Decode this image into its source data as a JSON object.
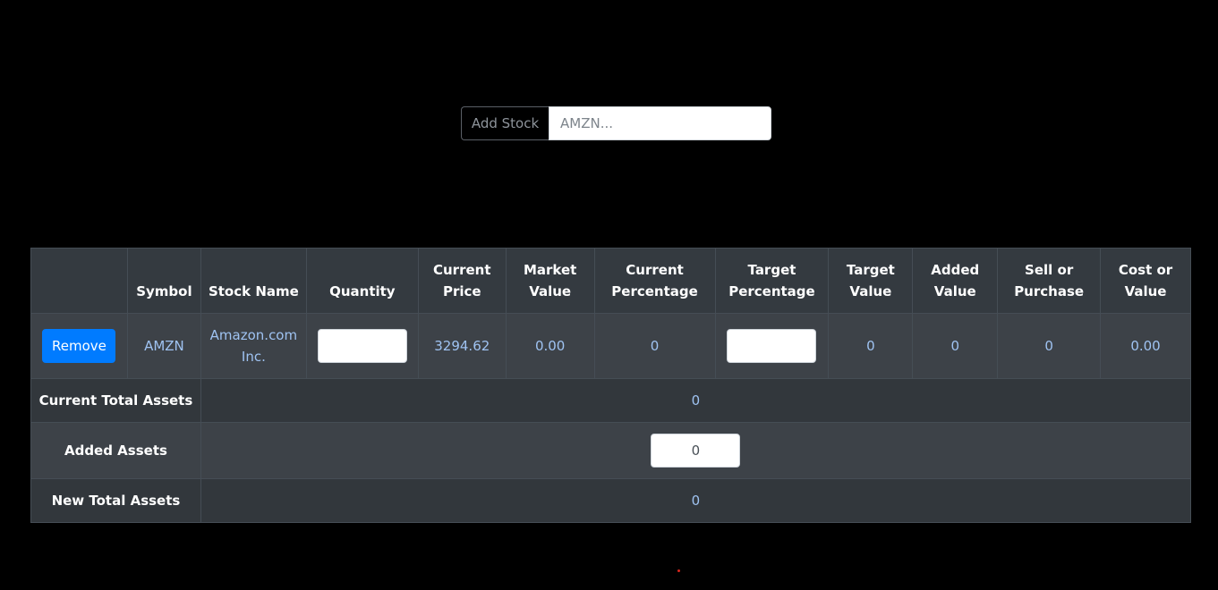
{
  "add_stock": {
    "label": "Add Stock",
    "placeholder": "AMZN...",
    "value": ""
  },
  "table": {
    "headers": {
      "action": "",
      "symbol": "Symbol",
      "stock_name": "Stock Name",
      "quantity": "Quantity",
      "current_price": "Current Price",
      "market_value": "Market Value",
      "current_percentage": "Current Percentage",
      "target_percentage": "Target Percentage",
      "target_value": "Target Value",
      "added_value": "Added Value",
      "sell_or_purchase": "Sell or Purchase",
      "cost_or_value": "Cost or Value"
    },
    "rows": [
      {
        "remove_label": "Remove",
        "symbol": "AMZN",
        "stock_name": "Amazon.com Inc.",
        "quantity": "",
        "current_price": "3294.62",
        "market_value": "0.00",
        "current_percentage": "0",
        "target_percentage": "",
        "target_value": "0",
        "added_value": "0",
        "sell_or_purchase": "0",
        "cost_or_value": "0.00"
      }
    ]
  },
  "summary": {
    "current_total_assets": {
      "label": "Current Total Assets",
      "value": "0"
    },
    "added_assets": {
      "label": "Added Assets",
      "value": "0"
    },
    "new_total_assets": {
      "label": "New Total Assets",
      "value": "0"
    }
  },
  "colors": {
    "background": "#000000",
    "header_bg": "#343a40",
    "row_bg": "#3d4248",
    "value_text": "#9fc3f2",
    "button_primary": "#007bff",
    "cursor_dot": "#d9261c"
  }
}
